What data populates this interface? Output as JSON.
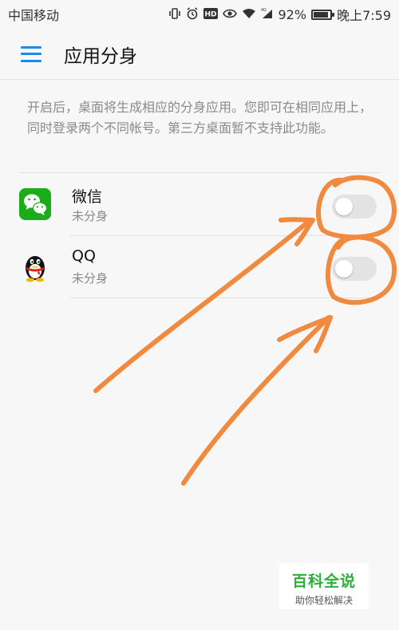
{
  "status_bar": {
    "carrier": "中国移动",
    "hd_label": "HD",
    "network_label": "4G",
    "battery": "92%",
    "battery_level": 0.92,
    "time": "晚上7:59",
    "icons": [
      "vibrate-icon",
      "alarm-icon",
      "hd-icon",
      "eye-icon",
      "wifi-icon",
      "signal-icon",
      "battery-icon"
    ]
  },
  "header": {
    "title": "应用分身",
    "menu_icon": "menu-icon",
    "menu_color": "#1e88e5"
  },
  "description": "开启后，桌面将生成相应的分身应用。您即可在相同应用上，同时登录两个不同帐号。第三方桌面暂不支持此功能。",
  "apps": [
    {
      "name": "微信",
      "status": "未分身",
      "icon": "wechat-icon",
      "toggle_on": false
    },
    {
      "name": "QQ",
      "status": "未分身",
      "icon": "qq-icon",
      "toggle_on": false
    }
  ],
  "annotation_color": "#f08a3e",
  "watermark": {
    "title": "百科全说",
    "subtitle": "助你轻松解决"
  }
}
